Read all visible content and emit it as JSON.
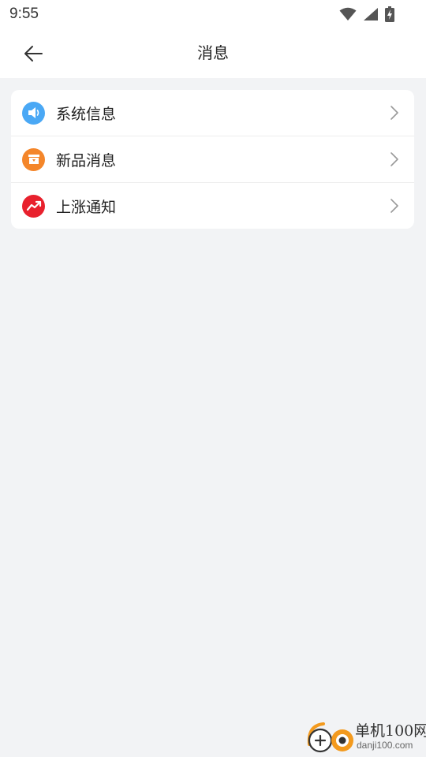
{
  "status_bar": {
    "time": "9:55",
    "icons": [
      "wifi-icon",
      "signal-icon",
      "battery-charging-icon"
    ]
  },
  "header": {
    "title": "消息",
    "back_icon": "arrow-left-icon"
  },
  "list": {
    "items": [
      {
        "label": "系统信息",
        "icon": "speaker-icon",
        "icon_color": "#4aa8f5"
      },
      {
        "label": "新品消息",
        "icon": "box-icon",
        "icon_color": "#f4862a"
      },
      {
        "label": "上涨通知",
        "icon": "trending-up-icon",
        "icon_color": "#e8212d"
      }
    ]
  },
  "watermark": {
    "title": "单机100网",
    "subtitle": "danji100.com"
  }
}
